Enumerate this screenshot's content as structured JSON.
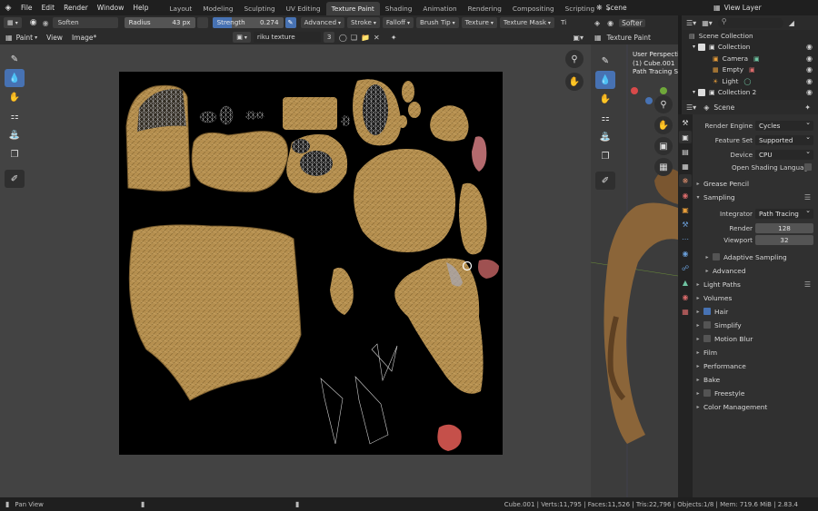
{
  "menu": [
    "File",
    "Edit",
    "Render",
    "Window",
    "Help"
  ],
  "workspaces": [
    "Layout",
    "Modeling",
    "Sculpting",
    "UV Editing",
    "Texture Paint",
    "Shading",
    "Animation",
    "Rendering",
    "Compositing",
    "Scripting"
  ],
  "active_workspace": "Texture Paint",
  "add_workspace": "+",
  "scene": "Scene",
  "view_layer": "View Layer",
  "tool_header": {
    "brush_name": "Soften",
    "radius_label": "Radius",
    "radius_value": "43 px",
    "strength_label": "Strength",
    "strength_value": "0.274",
    "strength_fraction": 0.274,
    "advanced": "Advanced",
    "stroke": "Stroke",
    "falloff": "Falloff",
    "brush_tip": "Brush Tip",
    "texture": "Texture",
    "texture_mask": "Texture Mask",
    "overflow": "Ti"
  },
  "image_header": {
    "mode": "Paint",
    "view": "View",
    "image": "Image*",
    "image_name": "riku texture",
    "users": "3"
  },
  "viewport": {
    "mode": "Texture Paint",
    "brush": "Softer",
    "view_name": "User Perspective",
    "object": "(1) Cube.001",
    "render_status": "Path Tracing Sa"
  },
  "outliner": {
    "root": "Scene Collection",
    "items": [
      {
        "label": "Collection",
        "type": "collection"
      },
      {
        "label": "Camera",
        "type": "camera"
      },
      {
        "label": "Empty",
        "type": "empty"
      },
      {
        "label": "Light",
        "type": "light"
      },
      {
        "label": "Collection 2",
        "type": "collection"
      }
    ]
  },
  "properties": {
    "context": "Scene",
    "render_engine_label": "Render Engine",
    "render_engine": "Cycles",
    "feature_set_label": "Feature Set",
    "feature_set": "Supported",
    "device_label": "Device",
    "device": "CPU",
    "osl_label": "Open Shading Language",
    "grease_pencil": "Grease Pencil",
    "sampling": "Sampling",
    "integrator_label": "Integrator",
    "integrator": "Path Tracing",
    "render_label": "Render",
    "render_samples": "128",
    "viewport_label": "Viewport",
    "viewport_samples": "32",
    "adaptive_sampling": "Adaptive Sampling",
    "advanced": "Advanced",
    "light_paths": "Light Paths",
    "volumes": "Volumes",
    "hair": "Hair",
    "simplify": "Simplify",
    "motion_blur": "Motion Blur",
    "film": "Film",
    "performance": "Performance",
    "bake": "Bake",
    "freestyle": "Freestyle",
    "color_management": "Color Management"
  },
  "status": {
    "left": "Pan View",
    "right": "Cube.001 | Verts:11,795 | Faces:11,526 | Tris:22,796 | Objects:1/8 | Mem: 719.6 MiB | 2.83.4"
  },
  "colors": {
    "accent": "#4772b3",
    "texture_gold": "#b58f4f",
    "paint_red": "#c5504a"
  }
}
